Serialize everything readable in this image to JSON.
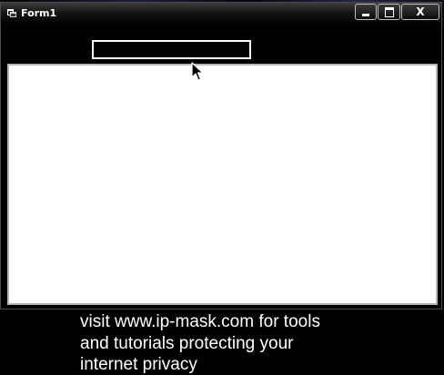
{
  "window": {
    "title": "Form1",
    "app_icon": "form-app-icon",
    "controls": {
      "minimize_icon": "minimize-icon",
      "maximize_icon": "maximize-icon",
      "close_icon": "close-icon",
      "close_glyph": "X"
    }
  },
  "form": {
    "text_field_value": "",
    "list_items": []
  },
  "caption": {
    "line1": "visit www.ip-mask.com for tools",
    "line2": "and tutorials protecting your",
    "line3": "internet privacy"
  },
  "colors": {
    "background": "#000000",
    "text": "#ffffff",
    "list_background": "#ffffff"
  }
}
